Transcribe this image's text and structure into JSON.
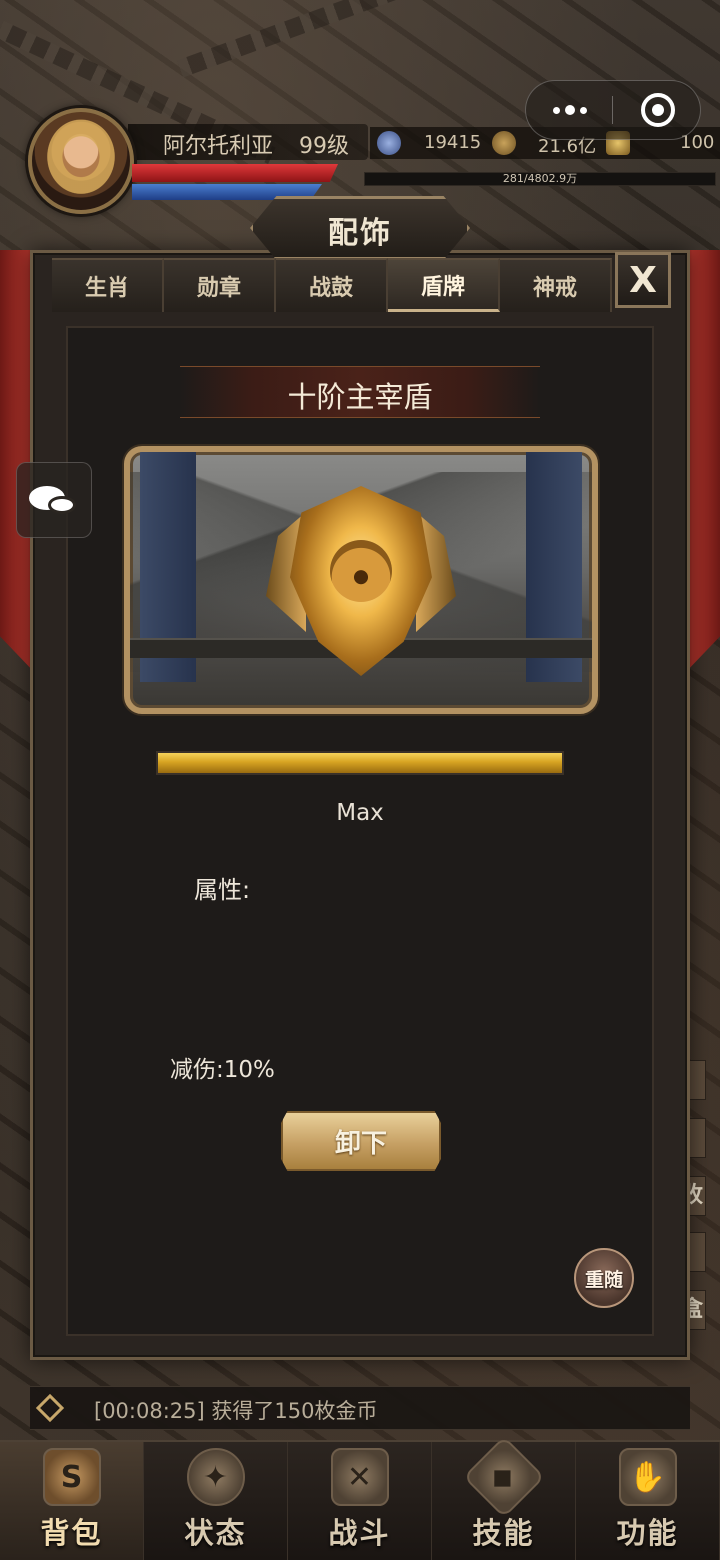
{
  "player": {
    "name": "阿尔托利亚",
    "level": "99级",
    "resources": [
      {
        "icon": "crystal-icon",
        "value": "19415"
      },
      {
        "icon": "coin-icon",
        "value": "21.6亿"
      },
      {
        "icon": "ingot-icon",
        "value": "100"
      }
    ],
    "exp_text": "281/4802.9万",
    "exp_fraction": 5.85e-05
  },
  "window": {
    "title": "配饰",
    "close_label": "X"
  },
  "tabs": [
    {
      "label": "生肖",
      "active": false
    },
    {
      "label": "勋章",
      "active": false
    },
    {
      "label": "战鼓",
      "active": false
    },
    {
      "label": "盾牌",
      "active": true
    },
    {
      "label": "神戒",
      "active": false
    }
  ],
  "item": {
    "name": "十阶主宰盾",
    "progress_fraction": 1.0,
    "progress_label": "Max",
    "attr_label": "属性:",
    "stat_text": "减伤:10%"
  },
  "buttons": {
    "unequip": "卸下",
    "reroll": "重随"
  },
  "side_slivers": [
    "",
    "",
    "收",
    "",
    "盒"
  ],
  "log": {
    "text": "[00:08:25] 获得了150枚金币"
  },
  "nav": [
    {
      "label": "背包",
      "icon": "bag-icon",
      "active": true
    },
    {
      "label": "状态",
      "icon": "status-icon",
      "active": false
    },
    {
      "label": "战斗",
      "icon": "battle-icon",
      "active": false
    },
    {
      "label": "技能",
      "icon": "skill-icon",
      "active": false
    },
    {
      "label": "功能",
      "icon": "function-icon",
      "active": false
    }
  ],
  "colors": {
    "accent_gold": "#d7a422",
    "hp_red": "#e0383a",
    "mp_blue": "#4a7fd0"
  }
}
